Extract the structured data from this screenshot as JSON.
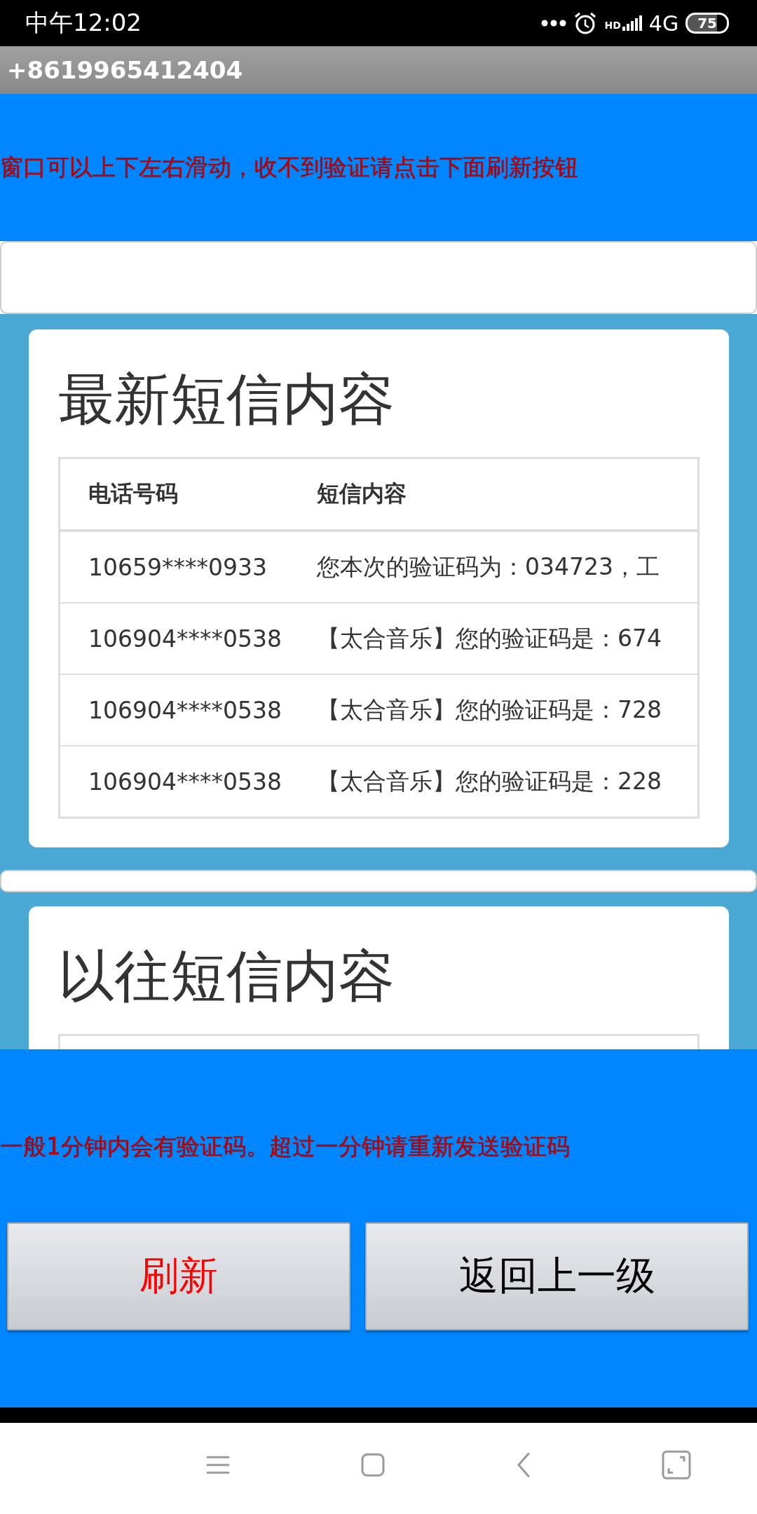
{
  "status_bar": {
    "time": "中午12:02",
    "network_badge": "HD",
    "network": "4G",
    "battery": "75"
  },
  "app_bar": {
    "title": "+8619965412404"
  },
  "top_notice": "窗口可以上下左右滑动，收不到验证请点击下面刷新按钮",
  "latest_card": {
    "title": "最新短信内容",
    "columns": [
      "电话号码",
      "短信内容"
    ],
    "rows": [
      [
        "10659****0933",
        "您本次的验证码为：034723，工"
      ],
      [
        "106904****0538",
        "【太合音乐】您的验证码是：674"
      ],
      [
        "106904****0538",
        "【太合音乐】您的验证码是：728"
      ],
      [
        "106904****0538",
        "【太合音乐】您的验证码是：228"
      ]
    ]
  },
  "past_card": {
    "title": "以往短信内容"
  },
  "bottom_notice": "一般1分钟内会有验证码。超过一分钟请重新发送验证码",
  "buttons": [
    {
      "label": "刷新",
      "kind": "primary"
    },
    {
      "label": "返回上一级",
      "kind": "normal"
    }
  ]
}
